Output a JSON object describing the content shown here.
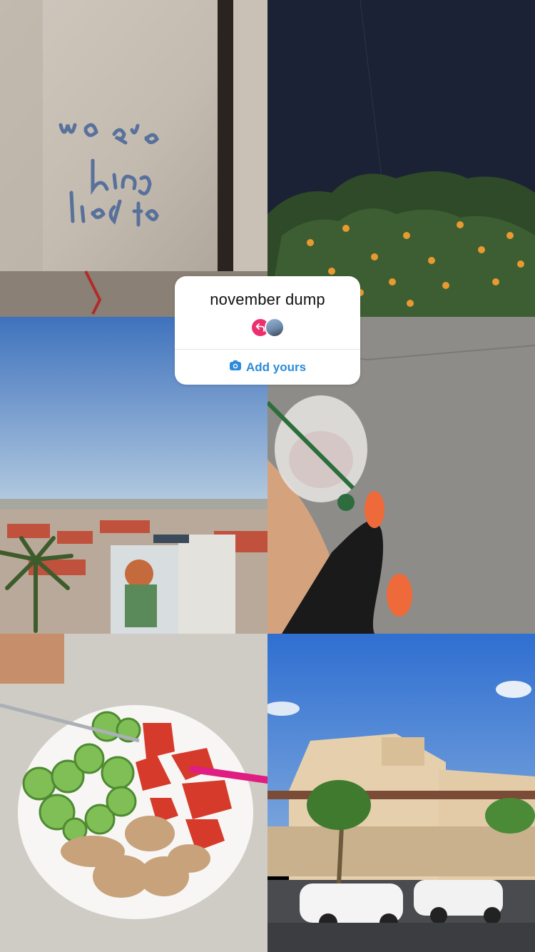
{
  "sticker": {
    "title": "november dump",
    "action_label": "Add yours"
  },
  "photos": [
    {
      "name": "graffiti-wall-photo",
      "caption_handwritten": "we are being lied to"
    },
    {
      "name": "orange-tree-night-photo"
    },
    {
      "name": "city-rooftops-photo"
    },
    {
      "name": "iced-drink-sidewalk-photo"
    },
    {
      "name": "salad-chicken-plate-photo"
    },
    {
      "name": "villa-building-photo"
    }
  ],
  "icons": {
    "camera": "camera-icon",
    "reply": "reply-arrow-icon"
  },
  "colors": {
    "accent": "#2a8bdb",
    "avatar_pink": "#ec2f6d"
  }
}
